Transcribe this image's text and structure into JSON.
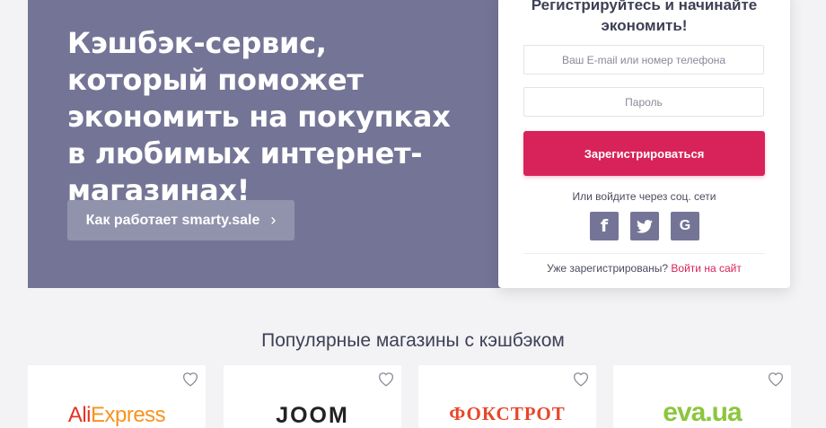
{
  "hero": {
    "title": "Кэшбэк-сервис, который поможет экономить на покупках в любимых интернет-магазинах!",
    "how_it_works_button": "Как работает smarty.sale",
    "colors": {
      "background": "#747596",
      "button": "#9193ad"
    }
  },
  "register_panel": {
    "heading": "Регистрируйтесь и начинайте экономить!",
    "email_placeholder": "Ваш E-mail или номер телефона",
    "password_placeholder": "Пароль",
    "register_button": "Зарегистрироваться",
    "social_label": "Или войдите через соц. сети",
    "social_buttons": [
      {
        "icon": "facebook-icon",
        "glyph": "f"
      },
      {
        "icon": "twitter-icon",
        "glyph": ""
      },
      {
        "icon": "google-icon",
        "glyph": "G"
      }
    ],
    "already_registered": "Уже зарегистрированы?",
    "login_link": "Войти на сайт",
    "colors": {
      "accent": "#d8235a",
      "social": "#747596"
    }
  },
  "stores": {
    "title": "Популярные магазины с кэшбэком",
    "items": [
      {
        "name": "AliExpress",
        "logo_part1": "Ali",
        "logo_part2": "Express",
        "favorite_icon": "heart-icon"
      },
      {
        "name": "JOOM",
        "logo_text": "JOOM",
        "favorite_icon": "heart-icon"
      },
      {
        "name": "ФОКСТРОТ",
        "logo_text": "ФОКСТРОТ",
        "favorite_icon": "heart-icon"
      },
      {
        "name": "eva.ua",
        "logo_text": "eva.ua",
        "favorite_icon": "heart-icon"
      }
    ]
  }
}
